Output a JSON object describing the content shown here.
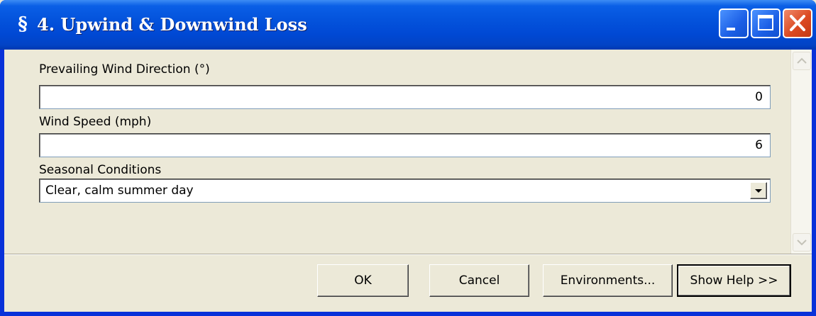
{
  "window": {
    "title": "4. Upwind & Downwind Loss",
    "icon": "arcgis-tool-icon"
  },
  "form": {
    "wind_direction": {
      "label": "Prevailing Wind Direction (°)",
      "value": "0"
    },
    "wind_speed": {
      "label": "Wind Speed (mph)",
      "value": "6"
    },
    "seasonal_conditions": {
      "label": "Seasonal Conditions",
      "value": "Clear, calm summer day"
    }
  },
  "buttons": {
    "ok": "OK",
    "cancel": "Cancel",
    "environments": "Environments...",
    "show_help": "Show Help >>"
  },
  "colors": {
    "titlebar": "#0054e3",
    "close_button": "#dc4a22",
    "face": "#ece9d8"
  }
}
